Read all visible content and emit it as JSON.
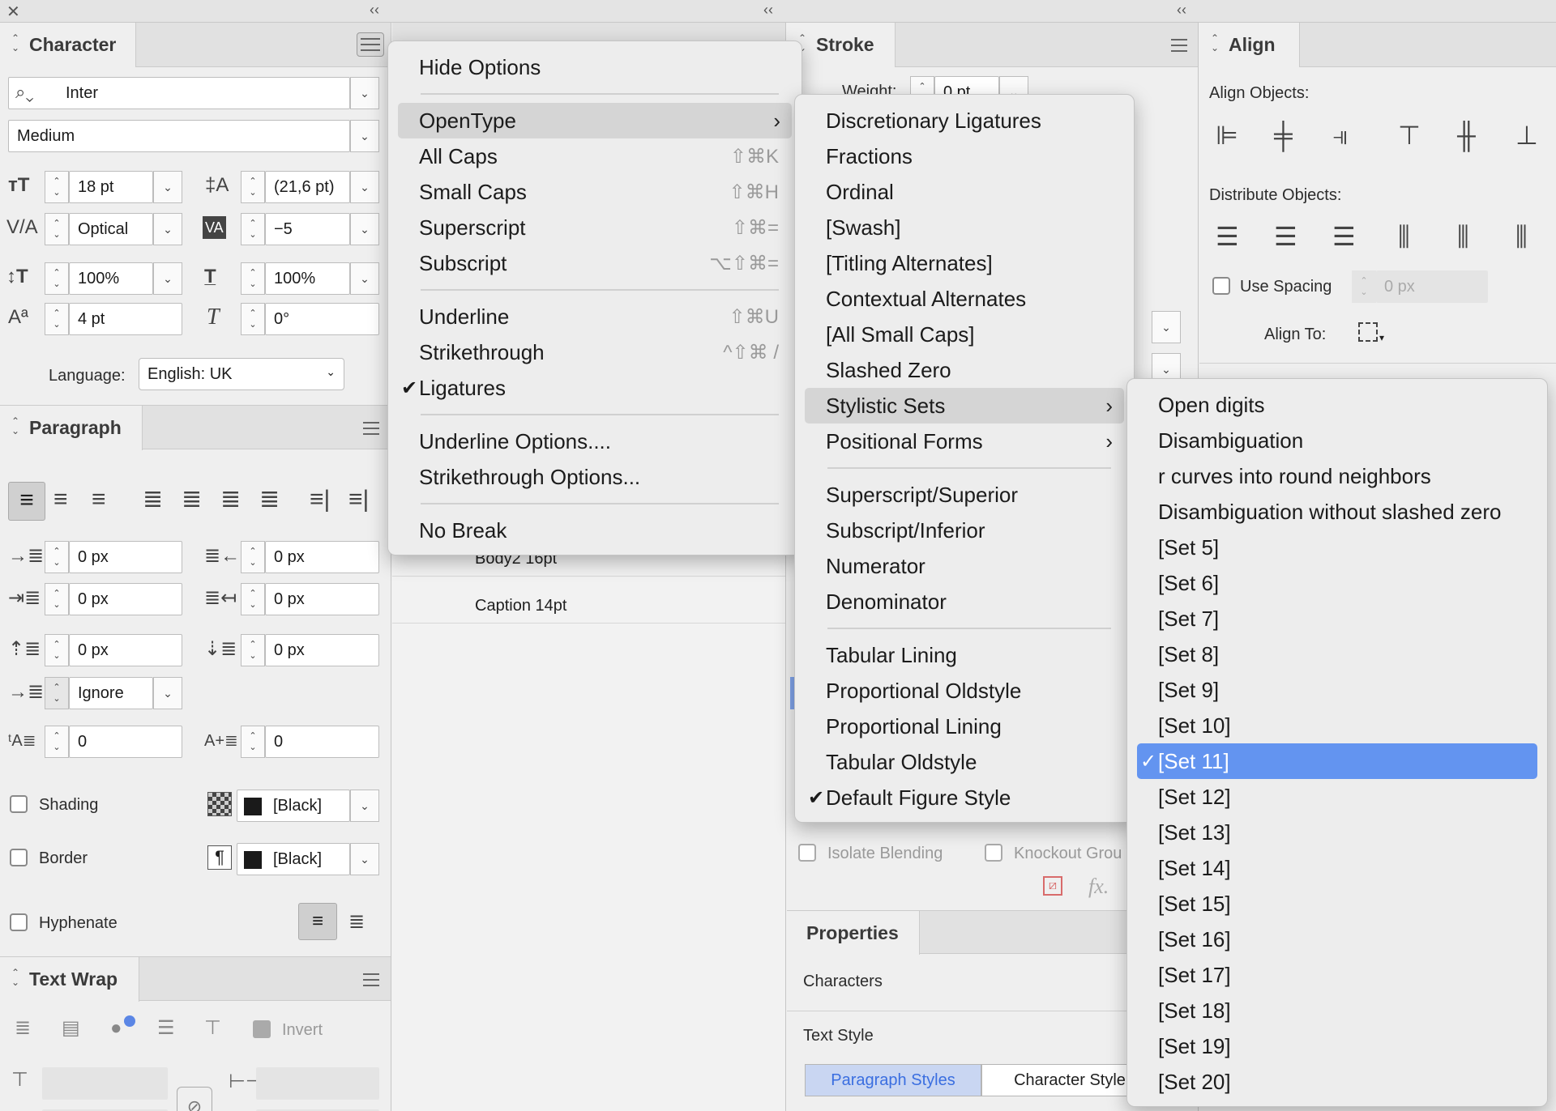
{
  "character_panel": {
    "title": "Character",
    "font_family": "Inter",
    "font_style": "Medium",
    "size": "18 pt",
    "leading": "(21,6 pt)",
    "kerning": "Optical",
    "tracking": "−5",
    "vertical_scale": "100%",
    "horizontal_scale": "100%",
    "baseline_shift": "4 pt",
    "skew": "0°",
    "language_label": "Language:",
    "language_value": "English: UK"
  },
  "paragraph_panel": {
    "title": "Paragraph",
    "left_indent": "0 px",
    "right_indent": "0 px",
    "first_line_indent": "0 px",
    "last_line_indent": "0 px",
    "space_before": "0 px",
    "space_after": "0 px",
    "align_to_grid": "Ignore",
    "drop_cap_lines": "0",
    "drop_cap_chars": "0",
    "shading_label": "Shading",
    "shading_color": "[Black]",
    "border_label": "Border",
    "border_color": "[Black]",
    "hyphenate_label": "Hyphenate"
  },
  "text_wrap_panel": {
    "title": "Text Wrap",
    "invert_label": "Invert"
  },
  "paragraph_styles_panel": {
    "items": [
      "Body2 16pt",
      "Caption 14pt"
    ]
  },
  "stroke_panel": {
    "title": "Stroke",
    "weight_label": "Weight:",
    "weight_value": "0 pt",
    "isolate_blending": "Isolate Blending",
    "knockout_group": "Knockout Grou",
    "fx_label": "fx."
  },
  "properties_panel": {
    "title": "Properties",
    "characters": "Characters",
    "text_style": "Text Style",
    "tab_paragraph_styles": "Paragraph Styles",
    "tab_character_styles": "Character Style"
  },
  "align_panel": {
    "title": "Align",
    "align_objects": "Align Objects:",
    "distribute_objects": "Distribute Objects:",
    "use_spacing": "Use Spacing",
    "spacing_value": "0 px",
    "align_to": "Align To:"
  },
  "main_menu": {
    "items": [
      {
        "label": "Hide Options",
        "shortcut": ""
      },
      {
        "label": "OpenType",
        "shortcut": ""
      },
      {
        "label": "All Caps",
        "shortcut": "⇧⌘K"
      },
      {
        "label": "Small Caps",
        "shortcut": "⇧⌘H"
      },
      {
        "label": "Superscript",
        "shortcut": "⇧⌘="
      },
      {
        "label": "Subscript",
        "shortcut": "⌥⇧⌘="
      },
      {
        "label": "Underline",
        "shortcut": "⇧⌘U"
      },
      {
        "label": "Strikethrough",
        "shortcut": "^⇧⌘ /"
      },
      {
        "label": "Ligatures",
        "shortcut": ""
      },
      {
        "label": "Underline Options....",
        "shortcut": ""
      },
      {
        "label": "Strikethrough Options...",
        "shortcut": ""
      },
      {
        "label": "No Break",
        "shortcut": ""
      }
    ]
  },
  "opentype_menu": {
    "items": [
      "Discretionary Ligatures",
      "Fractions",
      "Ordinal",
      "[Swash]",
      "[Titling Alternates]",
      "Contextual Alternates",
      "[All Small Caps]",
      "Slashed Zero",
      "Stylistic Sets",
      "Positional Forms",
      "Superscript/Superior",
      "Subscript/Inferior",
      "Numerator",
      "Denominator",
      "Tabular Lining",
      "Proportional Oldstyle",
      "Proportional Lining",
      "Tabular Oldstyle",
      "Default Figure Style"
    ]
  },
  "stylistic_sets_menu": {
    "items": [
      "Open digits",
      "Disambiguation",
      "r curves into round neighbors",
      "Disambiguation without slashed zero",
      "[Set 5]",
      "[Set 6]",
      "[Set 7]",
      "[Set 8]",
      "[Set 9]",
      "[Set 10]",
      "[Set 11]",
      "[Set 12]",
      "[Set 13]",
      "[Set 14]",
      "[Set 15]",
      "[Set 16]",
      "[Set 17]",
      "[Set 18]",
      "[Set 19]",
      "[Set 20]"
    ],
    "selected": "[Set 11]"
  },
  "colors": {
    "menu_highlight": "#6394f0",
    "panel_bg": "#efefef"
  }
}
